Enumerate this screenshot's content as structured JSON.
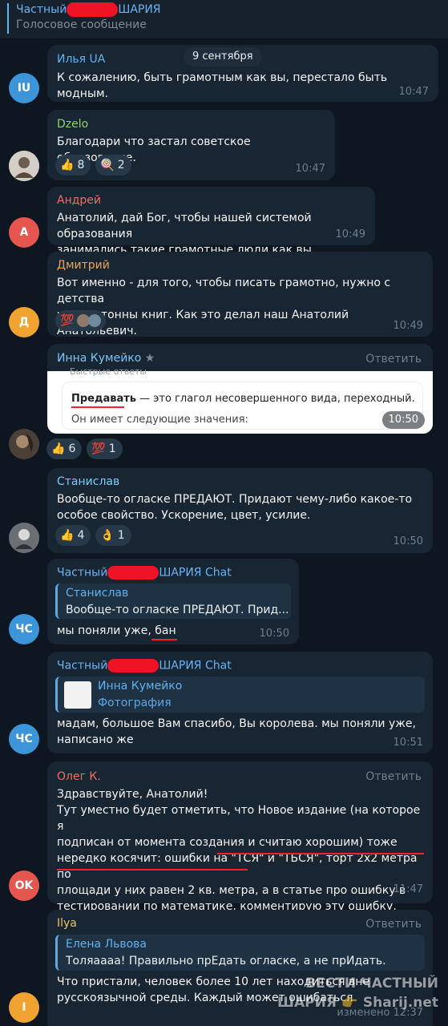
{
  "header": {
    "title_prefix": "Частный",
    "title_suffix": "ШАРИЯ",
    "subtitle": "Голосовое сообщение"
  },
  "date_label": "9 сентября",
  "reply_label": "Ответить",
  "messages": [
    {
      "author": "Илья UA",
      "avatar_initials": "IU",
      "text": "К сожалению, быть грамотным как вы, перестало быть модным.",
      "time": "10:47"
    },
    {
      "author": "Dzelo",
      "text": "Благодари что застал советское образование.",
      "time": "10:47",
      "reactions": [
        {
          "emoji": "👍",
          "count": "8"
        },
        {
          "emoji": "🍭",
          "count": "2"
        }
      ]
    },
    {
      "author": "Андрей",
      "avatar_initials": "А",
      "text": "Анатолий, дай Бог, чтобы нашей системой образования\nзанимались такие грамотные люди как вы.",
      "time": "10:49"
    },
    {
      "author": "Дмитрий",
      "avatar_initials": "Д",
      "text": "Вот именно - для того, чтобы писать грамотно, нужно с детства\nчитать тонны книг. Как это делал наш Анатолий Анатольевич.",
      "time": "10:49",
      "reactions": [
        {
          "emoji": "💯",
          "count": ""
        }
      ]
    },
    {
      "author": "Инна Кумейко",
      "author_badge": "★",
      "time": "10:50",
      "photo": {
        "header": "Быстрые ответы",
        "word": "Предавать",
        "definition": " — это глагол несовершенного вида, переходный.",
        "line2": "Он имеет следующие значения:"
      },
      "reactions": [
        {
          "emoji": "👍",
          "count": "6"
        },
        {
          "emoji": "💯",
          "count": "1"
        }
      ]
    },
    {
      "author": "Станислав",
      "text": "Вообще-то огласке ПРЕДАЮТ. Придают чему-либо какое-то\nособое свойство. Ускорение, цвет, усилие.",
      "time": "10:50",
      "reactions": [
        {
          "emoji": "👍",
          "count": "4"
        },
        {
          "emoji": "👌",
          "count": "1"
        }
      ]
    },
    {
      "author_prefix": "Частный",
      "author_suffix": "ШАРИЯ Chat",
      "avatar_initials": "ЧС",
      "time": "10:50",
      "quote": {
        "name": "Станислав",
        "text": "Вообще-то огласке ПРЕДАЮТ. Прид..."
      },
      "text": "мы поняли уже, бан"
    },
    {
      "author_prefix": "Частный",
      "author_suffix": "ШАРИЯ Chat",
      "avatar_initials": "ЧС",
      "time": "10:51",
      "quote": {
        "name": "Инна Кумейко",
        "text": "Фотография"
      },
      "text": "мадам, большое Вам спасибо, Вы королева. мы поняли уже,\nнаписано же"
    },
    {
      "author": "Олег К.",
      "avatar_initials": "OK",
      "time": "11:47",
      "text": "Здравствуйте, Анатолий!\nТут уместно будет отметить, что Новое издание (на которое я\nподписан от момента создания и считаю хорошим) тоже\nнередко косячит: ошибки на \"ТСЯ\" и \"ТЬСЯ\", торт 2х2 метра по\nплощади у них равен 2 кв. метра, а в статье про ошибку в\nтестировании по математике, комментирую эту ошибку, сами\nошибаются."
    },
    {
      "author": "Ilya",
      "avatar_initials": "I",
      "time": "изменено 12:37",
      "quote": {
        "name": "Елена Львова",
        "text": "Толяаааа! Правильно прЕдать огласке, а не прИдать."
      },
      "text": "Что пристали, человек более 10 лет находиться вне\nрусскоязычной среды. Каждый может ошибаться"
    }
  ],
  "watermark": {
    "line1": "ВЕСТИ ЧАСТНЫЙ",
    "line2": "ШАРИЯ 👉 Sharij.net"
  },
  "colors": {
    "background": "#0e1621",
    "bubble": "#182533",
    "accent": "#6ab3f3",
    "name_ilya_ua": "#62b1f0",
    "name_dzelo": "#8ed36c",
    "name_andrey": "#ef6f64",
    "name_dmitriy": "#e9a452",
    "name_inna": "#7fc3f5",
    "name_stanislav": "#7bcdf5",
    "name_chat": "#6ab3f3",
    "name_oleg": "#ef6f64",
    "name_ilya": "#e9c46a"
  }
}
